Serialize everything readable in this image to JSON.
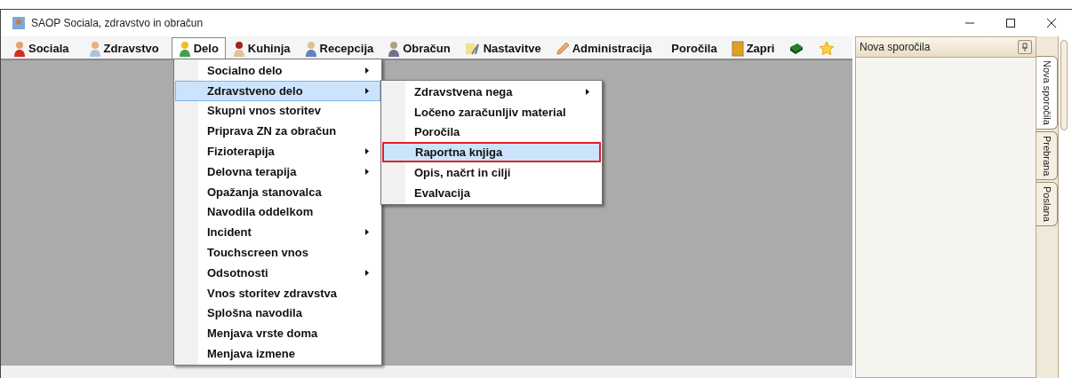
{
  "window": {
    "title": "SAOP Sociala, zdravstvo in obračun"
  },
  "menu_bar": [
    {
      "label": "Sociala",
      "kind": "person",
      "selected": false
    },
    {
      "label": "Zdravstvo",
      "kind": "doctor",
      "selected": false
    },
    {
      "label": "Delo",
      "kind": "worker",
      "selected": true
    },
    {
      "label": "Kuhinja",
      "kind": "chef",
      "selected": false
    },
    {
      "label": "Recepcija",
      "kind": "receptionist",
      "selected": false
    },
    {
      "label": "Obračun",
      "kind": "clerk",
      "selected": false
    },
    {
      "label": "Nastavitve",
      "kind": "tools",
      "selected": false
    },
    {
      "label": "Administracija",
      "kind": "pencil",
      "selected": false
    },
    {
      "label": "Poročila",
      "kind": "text",
      "selected": false
    },
    {
      "label": "Zapri",
      "kind": "door",
      "selected": false
    },
    {
      "kind": "book",
      "selected": false
    },
    {
      "kind": "star",
      "selected": false
    }
  ],
  "menu": [
    {
      "label": "Socialno delo",
      "submenu": true,
      "selected": false
    },
    {
      "label": "Zdravstveno delo",
      "submenu": true,
      "selected": true
    },
    {
      "label": "Skupni vnos storitev",
      "submenu": false,
      "selected": false
    },
    {
      "label": "Priprava ZN za obračun",
      "submenu": false,
      "selected": false
    },
    {
      "label": "Fizioterapija",
      "submenu": true,
      "selected": false
    },
    {
      "label": "Delovna terapija",
      "submenu": true,
      "selected": false
    },
    {
      "label": "Opažanja stanovalca",
      "submenu": false,
      "selected": false
    },
    {
      "label": "Navodila oddelkom",
      "submenu": false,
      "selected": false
    },
    {
      "label": "Incident",
      "submenu": true,
      "selected": false
    },
    {
      "label": "Touchscreen vnos",
      "submenu": false,
      "selected": false
    },
    {
      "label": "Odsotnosti",
      "submenu": true,
      "selected": false
    },
    {
      "label": "Vnos storitev zdravstva",
      "submenu": false,
      "selected": false
    },
    {
      "label": "Splošna navodila",
      "submenu": false,
      "selected": false
    },
    {
      "label": "Menjava vrste doma",
      "submenu": false,
      "selected": false
    },
    {
      "label": "Menjava izmene",
      "submenu": false,
      "selected": false
    }
  ],
  "submenu": [
    {
      "label": "Zdravstvena nega",
      "submenu": true,
      "selected": false,
      "outlined": false
    },
    {
      "label": "Ločeno zaračunljiv material",
      "submenu": false,
      "selected": false,
      "outlined": false
    },
    {
      "label": "Poročila",
      "submenu": false,
      "selected": false,
      "outlined": false
    },
    {
      "label": "Raportna knjiga",
      "submenu": false,
      "selected": true,
      "outlined": true
    },
    {
      "label": "Opis, načrt in cilji",
      "submenu": false,
      "selected": false,
      "outlined": false
    },
    {
      "label": "Evalvacija",
      "submenu": false,
      "selected": false,
      "outlined": false
    }
  ],
  "side_panel": {
    "title": "Nova sporočila",
    "tabs": [
      {
        "label": "Nova sporočila",
        "selected": true
      },
      {
        "label": "Prebrana",
        "selected": false
      },
      {
        "label": "Poslana",
        "selected": false
      }
    ]
  }
}
